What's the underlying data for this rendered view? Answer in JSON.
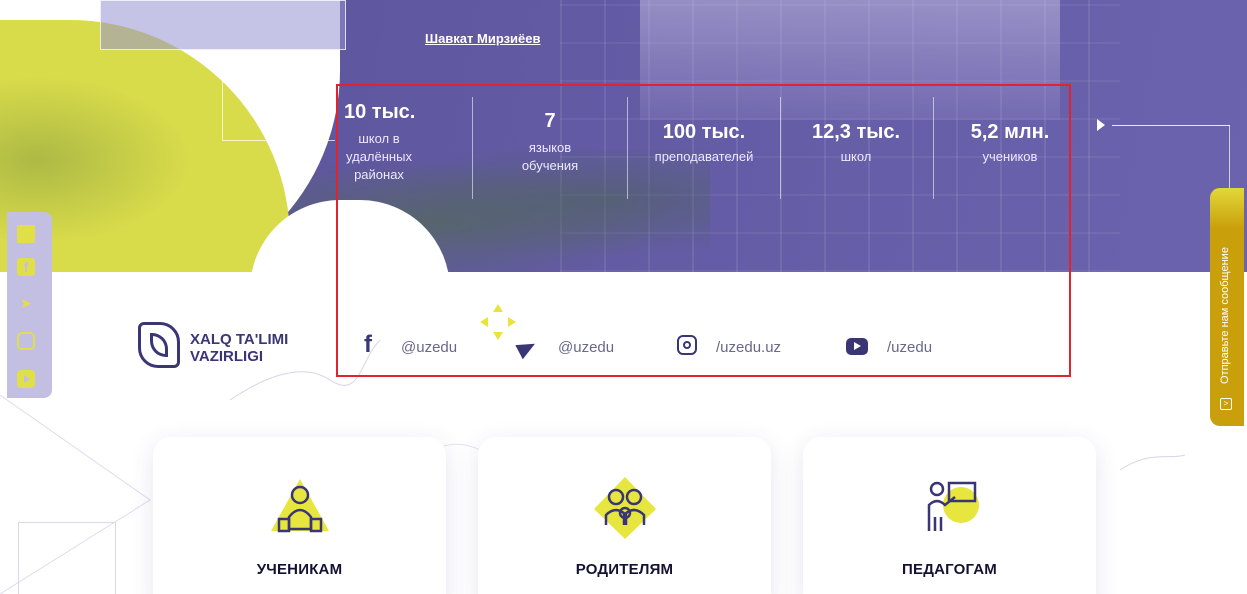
{
  "hero": {
    "author_link": "Шавкат Мирзиёев"
  },
  "stats": [
    {
      "value": "10 тыс.",
      "label": "школ в\nудалённых\nрайонах"
    },
    {
      "value": "7",
      "label": "языков\nобучения"
    },
    {
      "value": "100 тыс.",
      "label": "преподавателей"
    },
    {
      "value": "12,3 тыс.",
      "label": "школ"
    },
    {
      "value": "5,2 млн.",
      "label": "учеников"
    }
  ],
  "logo": {
    "line1": "XALQ TA'LIMI",
    "line2": "VAZIRLIGI"
  },
  "social": {
    "facebook": "@uzedu",
    "telegram": "@uzedu",
    "instagram": "/uzedu.uz",
    "youtube": "/uzedu"
  },
  "side_social_icons": [
    "mail-icon",
    "facebook-icon",
    "telegram-icon",
    "instagram-icon",
    "youtube-icon"
  ],
  "feedback_tab": {
    "label": "Отправьте нам сообщение"
  },
  "cards": [
    {
      "label": "УЧЕНИКАМ",
      "icon": "students-icon"
    },
    {
      "label": "РОДИТЕЛЯМ",
      "icon": "parents-icon"
    },
    {
      "label": "ПЕДАГОГАМ",
      "icon": "teachers-icon"
    }
  ],
  "colors": {
    "hero_purple": "#625aa3",
    "accent_yellow": "#d9dc4a",
    "highlight_red": "#e0232c",
    "text_dark": "#141233",
    "feedback_gold": "#c9a00c"
  }
}
